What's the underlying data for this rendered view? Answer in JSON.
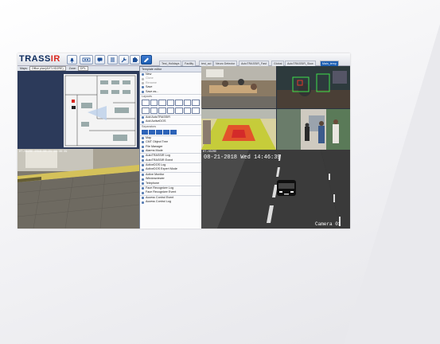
{
  "app": {
    "logo_main": "TRASS",
    "logo_accent": "IR"
  },
  "colors": {
    "brand_red": "#d9271e",
    "brand_navy": "#0b2a5c",
    "accent_blue": "#1d5fb3"
  },
  "toolbar": {
    "buttons": [
      {
        "name": "bell-icon"
      },
      {
        "name": "video-wall-icon"
      },
      {
        "name": "chat-icon"
      },
      {
        "name": "list-icon"
      },
      {
        "name": "wrench-icon"
      },
      {
        "name": "puzzle-icon"
      },
      {
        "name": "edit-icon"
      }
    ],
    "tabs": [
      "Test_Holidays",
      "Facility",
      "test_aci",
      "Neuro Detector",
      "AutoTRASSIR_Fast",
      "Global",
      "AutoTRASSIR_Slow",
      "Main_temp"
    ],
    "active_tab": "Main_temp"
  },
  "map_bar": {
    "map_label": "Maps:",
    "map_value": "Office plan(AHT-HD2RE)",
    "zone_label": "Zone:",
    "zone_value": "DPL"
  },
  "menu": {
    "title": "Template editor",
    "items_top": [
      {
        "label": "New",
        "disabled": false
      },
      {
        "label": "Clone",
        "disabled": true
      },
      {
        "label": "Rename",
        "disabled": true
      },
      {
        "label": "Save",
        "disabled": false
      },
      {
        "label": "Save as...",
        "disabled": false
      }
    ],
    "layouts_label": "Layouts",
    "items_mid": [
      "Add AutoTRASSIR",
      "Add ActiveDOS"
    ],
    "separators_label": "Separators",
    "items_bottom": [
      "Map",
      "CMT Object Tree",
      "File Manager",
      "Alarms Mode",
      "AutoTRASSIR Log",
      "AutoTRASSIR Event",
      "ActiveDOS Log",
      "ActiveDOS Expert Mode",
      "Active Monitor",
      "Windowviewer",
      "Telephone",
      "Face Recognizer Log",
      "Face Recognizer Event",
      "Access Control Event",
      "Access Control Log"
    ]
  },
  "cameras": {
    "bottom_right_timestamp": "08-21-2018 Wed 14:46:39",
    "bottom_right_name": "Camera 01",
    "bottom_right_top_label": "HT-HD2RE",
    "bottom_left_top_label": "HT-HD2RE 2018-08-21 14:46:39"
  }
}
